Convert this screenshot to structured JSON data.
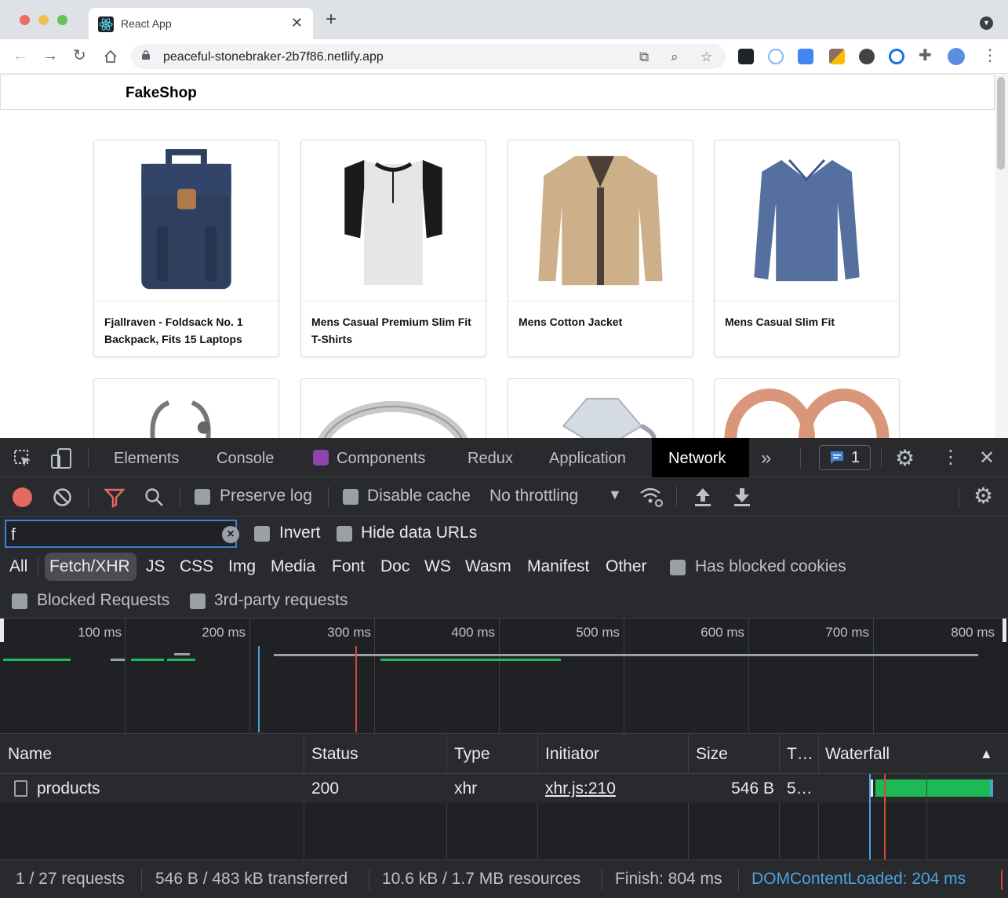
{
  "browser": {
    "tab_title": "React App",
    "url": "peaceful-stonebraker-2b7f86.netlify.app"
  },
  "page": {
    "brand": "FakeShop",
    "products": [
      {
        "title": "Fjallraven - Foldsack No. 1 Backpack, Fits 15 Laptops",
        "image": "backpack"
      },
      {
        "title": "Mens Casual Premium Slim Fit T-Shirts",
        "image": "t-shirt"
      },
      {
        "title": "Mens Cotton Jacket",
        "image": "jacket"
      },
      {
        "title": "Mens Casual Slim Fit",
        "image": "long-sleeve-shirt"
      },
      {
        "title": "",
        "image": "bracelet"
      },
      {
        "title": "",
        "image": "ring"
      },
      {
        "title": "",
        "image": "diamond-ring"
      },
      {
        "title": "",
        "image": "earrings"
      }
    ]
  },
  "devtools": {
    "tabs": [
      "Elements",
      "Console",
      "Components",
      "Redux",
      "Application",
      "Network"
    ],
    "active_tab": "Network",
    "more_tabs": "»",
    "issues_count": "1",
    "controls": {
      "preserve_log": "Preserve log",
      "disable_cache": "Disable cache",
      "throttling": "No throttling"
    },
    "filter": {
      "value": "f",
      "invert": "Invert",
      "hide_data_urls": "Hide data URLs",
      "types": [
        "All",
        "Fetch/XHR",
        "JS",
        "CSS",
        "Img",
        "Media",
        "Font",
        "Doc",
        "WS",
        "Wasm",
        "Manifest",
        "Other"
      ],
      "active_type": "Fetch/XHR",
      "has_blocked_cookies": "Has blocked cookies",
      "blocked_requests": "Blocked Requests",
      "third_party": "3rd-party requests"
    },
    "timeline_ticks": [
      "100 ms",
      "200 ms",
      "300 ms",
      "400 ms",
      "500 ms",
      "600 ms",
      "700 ms",
      "800 ms"
    ],
    "table": {
      "headers": {
        "name": "Name",
        "status": "Status",
        "type": "Type",
        "initiator": "Initiator",
        "size": "Size",
        "time": "T…",
        "waterfall": "Waterfall"
      },
      "rows": [
        {
          "name": "products",
          "status": "200",
          "type": "xhr",
          "initiator": "xhr.js:210",
          "size": "546 B",
          "time": "5…"
        }
      ]
    },
    "status_bar": {
      "requests": "1 / 27 requests",
      "transferred": "546 B / 483 kB transferred",
      "resources": "10.6 kB / 1.7 MB resources",
      "finish": "Finish: 804 ms",
      "dom_content_loaded": "DOMContentLoaded: 204 ms"
    },
    "colors": {
      "accent_blue": "#3f7fd6",
      "bar_green": "#1db954",
      "dcl_blue": "#4aa3df",
      "load_red": "#d14836"
    }
  }
}
